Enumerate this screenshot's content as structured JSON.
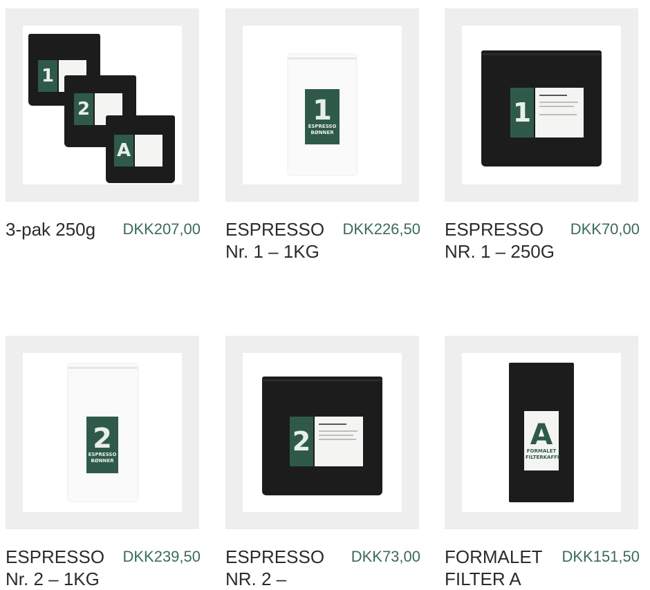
{
  "products": [
    {
      "name": "3-pak 250g",
      "price": "DKK207,00",
      "bag_glyphs": [
        "1",
        "2",
        "A"
      ]
    },
    {
      "name": "ESPRESSO Nr. 1 – 1KG",
      "price": "DKK226,50",
      "bag_glyph": "1",
      "bag_text": "ESPRESSO BØNNER"
    },
    {
      "name": "ESPRESSO NR. 1 – 250G",
      "price": "DKK70,00",
      "bag_glyph": "1"
    },
    {
      "name": "ESPRESSO Nr. 2 – 1KG",
      "price": "DKK239,50",
      "bag_glyph": "2",
      "bag_text": "ESPRESSO BØNNER"
    },
    {
      "name": "ESPRESSO NR. 2 –",
      "price": "DKK73,00",
      "bag_glyph": "2"
    },
    {
      "name": "FORMALET FILTER A",
      "price": "DKK151,50",
      "bag_glyph": "A",
      "bag_text": "FORMALET FILTERKAFFE"
    }
  ],
  "colors": {
    "price": "#3b6b55",
    "label_green": "#2f5a4a",
    "bag_black": "#1c1c1c",
    "thumb_bg": "#eeeeee"
  }
}
